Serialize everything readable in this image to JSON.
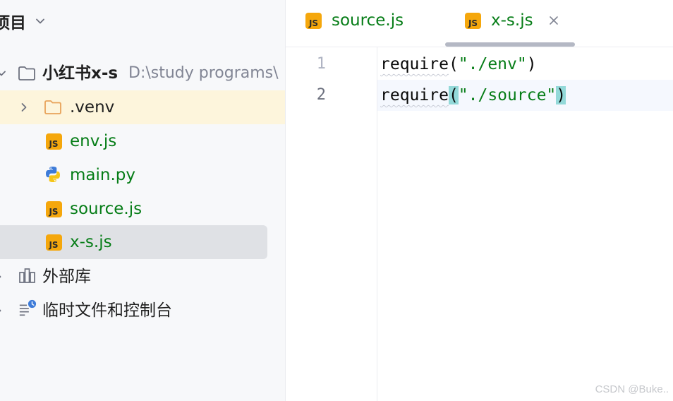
{
  "project_panel": {
    "title": "项目",
    "items": [
      {
        "label": "小红书x-s",
        "path": "D:\\study programs\\"
      },
      {
        "label": ".venv"
      },
      {
        "label": "env.js"
      },
      {
        "label": "main.py"
      },
      {
        "label": "source.js"
      },
      {
        "label": "x-s.js"
      },
      {
        "label": "外部库"
      },
      {
        "label": "临时文件和控制台"
      }
    ]
  },
  "editor": {
    "tabs": [
      {
        "label": "source.js",
        "icon_text": "JS",
        "active": false
      },
      {
        "label": "x-s.js",
        "icon_text": "JS",
        "active": true
      }
    ],
    "lines": [
      {
        "number": "1",
        "fn": "require",
        "open": "(",
        "str": "\"./env\"",
        "close": ")"
      },
      {
        "number": "2",
        "fn": "require",
        "open": "(",
        "str": "\"./source\"",
        "close": ")"
      }
    ]
  },
  "watermark": "CSDN @Buke..",
  "colors": {
    "file_green": "#067d17",
    "js_badge": "#f5a70c",
    "folder_orange": "#e8a35a",
    "highlight_row": "#fdf5dc",
    "selected_row": "#dfe1e5",
    "brace_match": "#93d9d9"
  },
  "icons": {
    "js": "js-file-icon",
    "python": "python-file-icon",
    "folder": "folder-icon",
    "library": "library-icon",
    "scratch": "scratches-icon"
  }
}
